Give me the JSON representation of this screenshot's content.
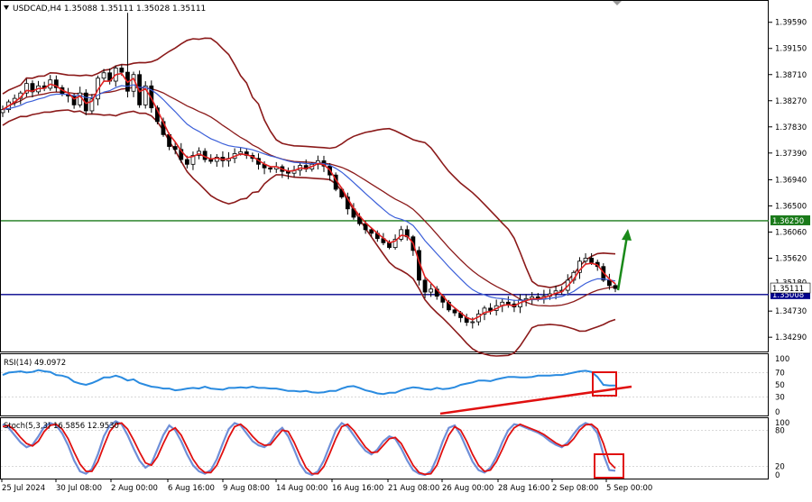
{
  "chart_data": [
    {
      "type": "line",
      "chart_kind": "candlestick",
      "title": "USDCAD,H4  1.35088 1.35111 1.35028 1.35111",
      "ylim": [
        1.3405,
        1.3995
      ],
      "y_ticks": [
        1.3959,
        1.3915,
        1.3871,
        1.3827,
        1.3783,
        1.3739,
        1.3694,
        1.365,
        1.3606,
        1.3562,
        1.3473,
        1.3429
      ],
      "y_tick_labels": [
        "1.39590",
        "1.39150",
        "1.38710",
        "1.38270",
        "1.37830",
        "1.37390",
        "1.36940",
        "1.36500",
        "1.36060",
        "1.35620",
        "1.34730",
        "1.34290"
      ],
      "hidden_tick_label": "1.35180",
      "x_tick_labels": [
        "25 Jul 2024",
        "30 Jul 08:00",
        "2 Aug 00:00",
        "6 Aug 16:00",
        "9 Aug 08:00",
        "14 Aug 00:00",
        "16 Aug 16:00",
        "21 Aug 08:00",
        "26 Aug 00:00",
        "28 Aug 16:00",
        "2 Sep 08:00",
        "5 Sep 00:00"
      ],
      "horizontal_lines": [
        {
          "label": "1.36250",
          "value": 1.3625,
          "color": "#1a7a1a"
        },
        {
          "label": "1.35008",
          "value": 1.35008,
          "color": "#00008b"
        }
      ],
      "price_marker": {
        "label": "1.35111",
        "value": 1.35111
      },
      "close_series": [
        1.3812,
        1.3825,
        1.3831,
        1.384,
        1.3856,
        1.3842,
        1.3852,
        1.3848,
        1.3862,
        1.3849,
        1.3838,
        1.3835,
        1.382,
        1.384,
        1.381,
        1.383,
        1.3865,
        1.3874,
        1.386,
        1.3882,
        1.3875,
        1.3843,
        1.3871,
        1.382,
        1.3852,
        1.3815,
        1.3792,
        1.377,
        1.375,
        1.3745,
        1.3728,
        1.372,
        1.3735,
        1.3742,
        1.3728,
        1.3725,
        1.3732,
        1.3726,
        1.373,
        1.3738,
        1.3741,
        1.3735,
        1.373,
        1.372,
        1.3714,
        1.3712,
        1.3716,
        1.3708,
        1.3705,
        1.371,
        1.3718,
        1.3712,
        1.372,
        1.3726,
        1.3717,
        1.3702,
        1.3678,
        1.3665,
        1.3645,
        1.3631,
        1.362,
        1.361,
        1.3604,
        1.3595,
        1.3588,
        1.358,
        1.3594,
        1.361,
        1.3598,
        1.3575,
        1.3525,
        1.3505,
        1.351,
        1.3498,
        1.3488,
        1.3475,
        1.347,
        1.3462,
        1.3454,
        1.3455,
        1.3468,
        1.3478,
        1.3474,
        1.3482,
        1.3488,
        1.3485,
        1.348,
        1.3492,
        1.3494,
        1.3497,
        1.3493,
        1.3498,
        1.3502,
        1.3507,
        1.3508,
        1.3525,
        1.3538,
        1.3557,
        1.3562,
        1.3555,
        1.3548,
        1.3525,
        1.3516,
        1.3511
      ]
    },
    {
      "type": "line",
      "title": "RSI(14) 49.0972",
      "ylim": [
        0,
        100
      ],
      "y_ticks": [
        100,
        70,
        50,
        30,
        0
      ],
      "y_tick_labels": [
        "100",
        "70",
        "50",
        "30",
        "0"
      ],
      "values": [
        66,
        70,
        71,
        72,
        70,
        71,
        74,
        72,
        71,
        66,
        65,
        62,
        55,
        52,
        50,
        53,
        57,
        62,
        62,
        65,
        62,
        57,
        59,
        53,
        50,
        47,
        46,
        44,
        44,
        41,
        42,
        44,
        45,
        44,
        47,
        44,
        43,
        42,
        45,
        45,
        46,
        45,
        47,
        45,
        45,
        44,
        44,
        42,
        40,
        40,
        39,
        40,
        38,
        37,
        38,
        40,
        40,
        44,
        47,
        48,
        45,
        41,
        39,
        36,
        35,
        37,
        37,
        41,
        44,
        46,
        45,
        43,
        42,
        45,
        43,
        44,
        46,
        50,
        52,
        54,
        57,
        57,
        56,
        59,
        61,
        63,
        63,
        62,
        62,
        63,
        65,
        65,
        65,
        66,
        66,
        68,
        70,
        72,
        73,
        71,
        63,
        50,
        49,
        49
      ]
    },
    {
      "type": "line",
      "title": "Stoch(5,3,3) 16.5856 12.9530",
      "ylim": [
        0,
        100
      ],
      "y_ticks": [
        100,
        80,
        20,
        0
      ],
      "y_tick_labels": [
        "100",
        "80",
        "20",
        "0"
      ],
      "series": [
        {
          "values": [
            90,
            84,
            72,
            60,
            52,
            56,
            70,
            86,
            92,
            88,
            75,
            55,
            30,
            12,
            8,
            16,
            40,
            70,
            88,
            95,
            90,
            72,
            50,
            30,
            18,
            25,
            48,
            72,
            88,
            80,
            62,
            40,
            22,
            12,
            8,
            14,
            32,
            58,
            82,
            92,
            88,
            75,
            62,
            55,
            52,
            60,
            76,
            84,
            70,
            48,
            24,
            10,
            6,
            12,
            30,
            55,
            80,
            92,
            86,
            72,
            58,
            46,
            40,
            48,
            62,
            70,
            66,
            50,
            30,
            14,
            8,
            6,
            12,
            34,
            62,
            84,
            88,
            72,
            50,
            28,
            14,
            10,
            18,
            36,
            60,
            80,
            90,
            88,
            84,
            80,
            76,
            70,
            62,
            56,
            52,
            60,
            74,
            86,
            92,
            88,
            75,
            40,
            14,
            13
          ]
        },
        {
          "values": [
            86,
            88,
            80,
            68,
            58,
            54,
            62,
            78,
            88,
            90,
            82,
            66,
            44,
            24,
            12,
            12,
            28,
            54,
            78,
            90,
            92,
            82,
            64,
            44,
            26,
            22,
            36,
            58,
            78,
            84,
            72,
            52,
            32,
            18,
            10,
            10,
            22,
            44,
            68,
            86,
            90,
            82,
            70,
            60,
            55,
            56,
            68,
            80,
            78,
            60,
            38,
            18,
            8,
            8,
            20,
            42,
            66,
            86,
            90,
            80,
            66,
            52,
            43,
            44,
            55,
            66,
            68,
            58,
            40,
            22,
            10,
            7,
            8,
            22,
            48,
            72,
            86,
            80,
            62,
            40,
            22,
            12,
            14,
            28,
            48,
            70,
            84,
            90,
            86,
            82,
            78,
            73,
            66,
            59,
            54,
            56,
            66,
            80,
            89,
            90,
            82,
            58,
            27,
            17
          ]
        }
      ]
    }
  ]
}
